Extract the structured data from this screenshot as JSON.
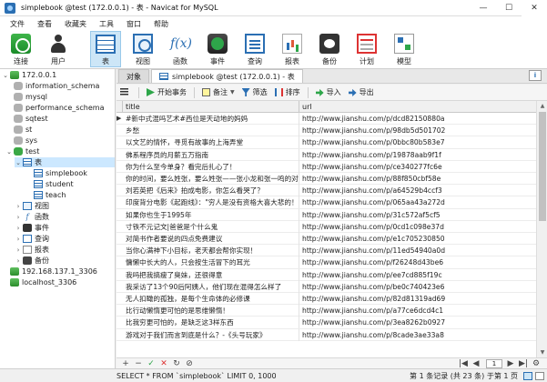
{
  "window": {
    "title": "simplebook @test (172.0.0.1) - 表 - Navicat for MySQL",
    "controls": {
      "minimize": "—",
      "maximize": "☐",
      "close": "✕"
    }
  },
  "menu": [
    "文件",
    "查看",
    "收藏夹",
    "工具",
    "窗口",
    "帮助"
  ],
  "toolbar": [
    {
      "label": "连接",
      "icon": "connection-icon"
    },
    {
      "label": "用户",
      "icon": "user-icon"
    },
    {
      "label": "表",
      "icon": "table-icon",
      "active": true
    },
    {
      "label": "视图",
      "icon": "view-icon"
    },
    {
      "label": "函数",
      "icon": "function-icon"
    },
    {
      "label": "事件",
      "icon": "event-icon"
    },
    {
      "label": "查询",
      "icon": "query-icon"
    },
    {
      "label": "报表",
      "icon": "report-icon"
    },
    {
      "label": "备份",
      "icon": "backup-icon"
    },
    {
      "label": "计划",
      "icon": "schedule-icon"
    },
    {
      "label": "模型",
      "icon": "model-icon"
    }
  ],
  "nav": {
    "connection1": "172.0.0.1",
    "databases": [
      "information_schema",
      "mysql",
      "performance_schema",
      "sqtest",
      "st",
      "sys"
    ],
    "open_db": "test",
    "tables_node": "表",
    "tables": [
      "simplebook",
      "student",
      "teach"
    ],
    "other_nodes": [
      "视图",
      "函数",
      "事件",
      "查询",
      "报表",
      "备份"
    ],
    "connection2": "192.168.137.1_3306",
    "connection3": "localhost_3306"
  },
  "tabs": {
    "objects": "对象",
    "active_tab": "simplebook @test (172.0.0.1) - 表"
  },
  "grid_toolbar": {
    "begin_txn": "开始事务",
    "note": "备注",
    "filter": "筛选",
    "sort": "排序",
    "import": "导入",
    "export": "导出"
  },
  "grid": {
    "columns": [
      "title",
      "url"
    ],
    "rows": [
      [
        "#新中式混吗艺术#西位是天动地的妈妈",
        "http://www.jianshu.com/p/dcd82150880a"
      ],
      [
        "乡愁",
        "http://www.jianshu.com/p/98db5d501702"
      ],
      [
        "以文艺的情怀，寻觅有故事的上海弄堂",
        "http://www.jianshu.com/p/0bbc80b583e7"
      ],
      [
        "佛系程序员的月薪五万指南",
        "http://www.jianshu.com/p/19878aab9f1f"
      ],
      [
        "你为什么至今单身？看完后扎心了！",
        "http://www.jianshu.com/p/ce340277fc6e"
      ],
      [
        "你的时间，要么姓张，要么姓张——张小龙和张一鸣的对决",
        "http://www.jianshu.com/p/88f850cbf58e"
      ],
      [
        "刘若英把《后来》拍成电影，你怎么看哭了？",
        "http://www.jianshu.com/p/a64529b4ccf3"
      ],
      [
        "印度背分电影《起跑线》：\"穷人是没有资格大喜大悲的！\"",
        "http://www.jianshu.com/p/065aa43a272d"
      ],
      [
        "如果你也生于1995年",
        "http://www.jianshu.com/p/31c572af5cf5"
      ],
      [
        "寸铁不元记文|爸爸是个什么鬼",
        "http://www.jianshu.com/p/0cd1c098e37d"
      ],
      [
        "对简书作者要说的四点免费建议",
        "http://www.jianshu.com/p/e1c705230850"
      ],
      [
        "当你心满神下小目标，老天都会帮你实现！",
        "http://www.jianshu.com/p/11ed54940a0d"
      ],
      [
        "慵懒中长大的人，只会按生活冒下的耳光",
        "http://www.jianshu.com/p/f26248d43be6"
      ],
      [
        "我吗把我搞瘦了臭妹，还很得意",
        "http://www.jianshu.com/p/ee7cd885f19c"
      ],
      [
        "我采访了13个90后阿姨人，他们现在混得怎么样了",
        "http://www.jianshu.com/p/be0c740423e6"
      ],
      [
        "无人扣瞰的孤独，是每个生命体的必修课",
        "http://www.jianshu.com/p/82d81319ad69"
      ],
      [
        "比行动懒惰更可怕的是思维懒惰！",
        "http://www.jianshu.com/p/a77ce6dcd4c1"
      ],
      [
        "比我穷更可怕的，是缺乏这3样东西",
        "http://www.jianshu.com/p/3ea8262b0927"
      ],
      [
        "游戏对于我们而言到底是什么？-《头号玩家》",
        "http://www.jianshu.com/p/8cade3ae33a8"
      ]
    ]
  },
  "bottom_nav": {
    "add": "+",
    "remove": "−",
    "save": "✓",
    "cancel": "✕",
    "refresh": "↻",
    "stop": "⊘",
    "first": "|◀",
    "prev": "◀",
    "page": "1",
    "next": "▶",
    "last": "▶|",
    "settings": "⚙"
  },
  "status": {
    "sql": "SELECT * FROM `simplebook` LIMIT 0, 1000",
    "count": "第 1 条记录 (共 23 条) 于第 1 页"
  }
}
